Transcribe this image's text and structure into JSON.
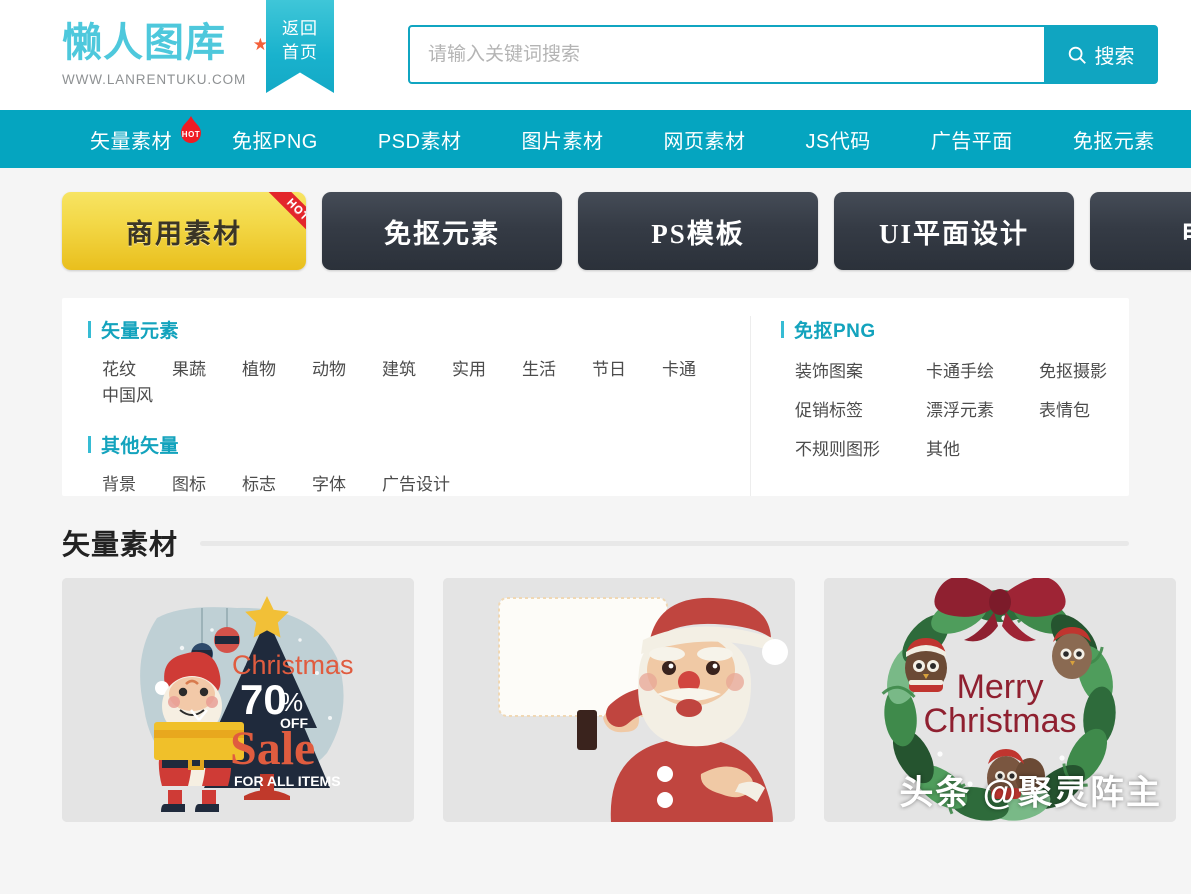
{
  "site": {
    "logo_text": "懒人图库",
    "logo_star": "★",
    "logo_url": "WWW.LANRENTUKU.COM",
    "ribbon_line1": "返回",
    "ribbon_line2": "首页"
  },
  "search": {
    "placeholder": "请输入关键词搜索",
    "value": "",
    "button_label": "搜索",
    "accent_color": "#10a5c1"
  },
  "nav": {
    "background_color": "#05a5c0",
    "items": [
      {
        "label": "矢量素材",
        "badge": "HOT"
      },
      {
        "label": "免抠PNG",
        "badge": ""
      },
      {
        "label": "PSD素材",
        "badge": ""
      },
      {
        "label": "图片素材",
        "badge": ""
      },
      {
        "label": "网页素材",
        "badge": ""
      },
      {
        "label": "JS代码",
        "badge": ""
      },
      {
        "label": "广告平面",
        "badge": ""
      },
      {
        "label": "免抠元素",
        "badge": ""
      }
    ]
  },
  "tabs": [
    {
      "label": "商用素材",
      "active": true,
      "corner_badge": "HOT",
      "color": "#eecf2e"
    },
    {
      "label": "免抠元素",
      "active": false,
      "corner_badge": "",
      "color": "#353b45"
    },
    {
      "label": "PS模板",
      "active": false,
      "corner_badge": "",
      "color": "#353b45"
    },
    {
      "label": "UI平面设计",
      "active": false,
      "corner_badge": "",
      "color": "#353b45"
    },
    {
      "label": "电商",
      "active": false,
      "corner_badge": "",
      "color": "#353b45"
    }
  ],
  "categories": {
    "heading_color": "#13a3bd",
    "left": [
      {
        "title": "矢量元素",
        "tags": [
          "花纹",
          "果蔬",
          "植物",
          "动物",
          "建筑",
          "实用",
          "生活",
          "节日",
          "卡通",
          "中国风"
        ]
      },
      {
        "title": "其他矢量",
        "tags": [
          "背景",
          "图标",
          "标志",
          "字体",
          "广告设计"
        ]
      }
    ],
    "right": {
      "title": "免抠PNG",
      "tags": [
        "装饰图案",
        "卡通手绘",
        "免抠摄影",
        "促销标签",
        "漂浮元素",
        "表情包",
        "不规则图形",
        "其他"
      ]
    }
  },
  "section": {
    "title": "矢量素材"
  },
  "cards": [
    {
      "name": "christmas-sale-santa",
      "text_lines": [
        "Christmas",
        "70",
        "%",
        "OFF",
        "Sale",
        "FOR ALL ITEMS"
      ]
    },
    {
      "name": "santa-blank-sign",
      "text_lines": []
    },
    {
      "name": "merry-christmas-wreath",
      "text_lines": [
        "Merry",
        "Christmas"
      ]
    }
  ],
  "watermark": {
    "text": "头条 @聚灵阵主"
  }
}
